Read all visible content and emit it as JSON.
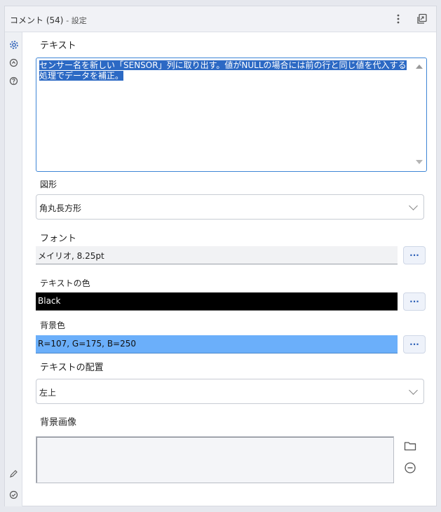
{
  "header": {
    "title": "コメント (54)",
    "suffix": "- 設定",
    "menu_icon": "more-vertical-icon",
    "popout_icon": "popout-window-icon"
  },
  "rail": {
    "icons": [
      "settings-gear-icon",
      "annotation-icon",
      "help-icon",
      "edit-pencil-icon",
      "check-circle-icon"
    ]
  },
  "form": {
    "text_label": "テキスト",
    "text_value": "センサー名を新しい「SENSOR」列に取り出す。値がNULLの場合には前の行と同じ値を代入する処理でデータを補正。",
    "shape_label": "図形",
    "shape_value": "角丸長方形",
    "font_label": "フォント",
    "font_value": "メイリオ, 8.25pt",
    "text_color_label": "テキストの色",
    "text_color_value": "Black",
    "bg_color_label": "背景色",
    "bg_color_value": "R=107, G=175, B=250",
    "alignment_label": "テキストの配置",
    "alignment_value": "左上",
    "bg_image_label": "背景画像",
    "more_button_label": "···"
  },
  "colors": {
    "accent": "#2f62b8",
    "selection": "#2c69c4",
    "text_color_swatch": "#000000",
    "bg_color_swatch": "#6bafFA"
  }
}
